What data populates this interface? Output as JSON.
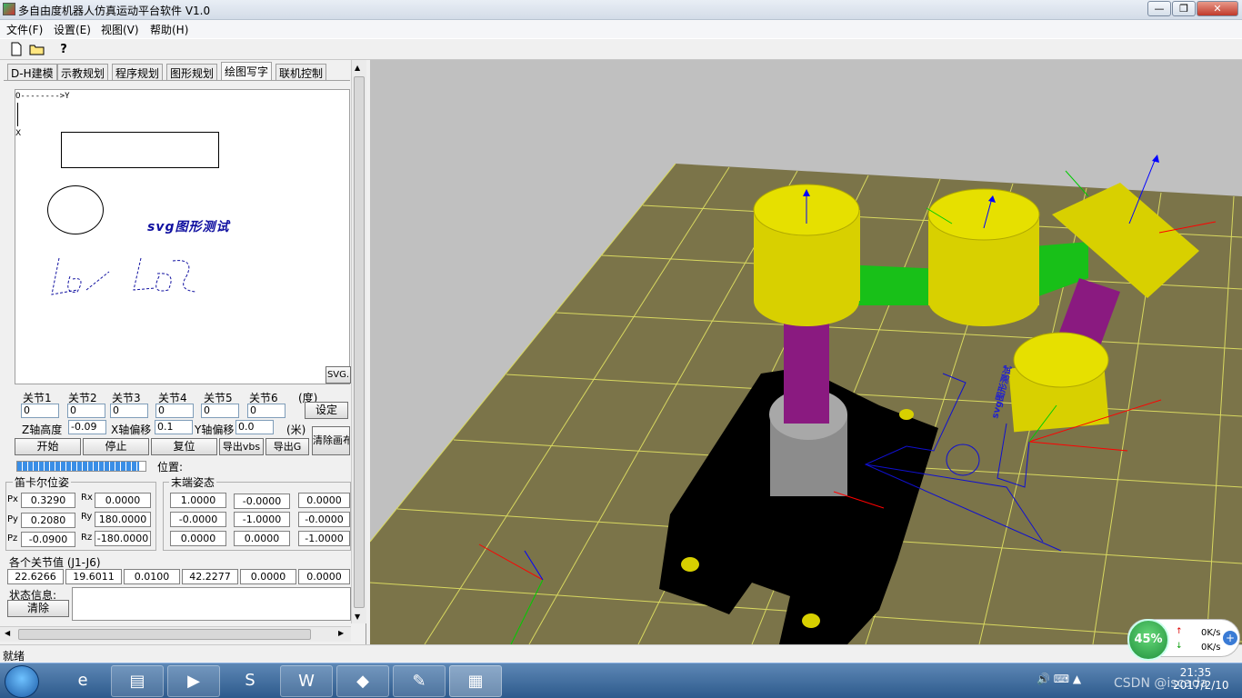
{
  "window": {
    "title": "多自由度机器人仿真运动平台软件 V1.0",
    "min": "—",
    "max": "❐",
    "close": "✕"
  },
  "menu": [
    "文件(F)",
    "设置(E)",
    "视图(V)",
    "帮助(H)"
  ],
  "toolbar": {
    "new_icon": "new-file-icon",
    "open_icon": "open-folder-icon",
    "help_icon": "help-icon",
    "help_label": "?"
  },
  "tabs": [
    "D-H建模",
    "示教规划",
    "程序规划",
    "图形规划",
    "绘图写字",
    "联机控制"
  ],
  "active_tab": 4,
  "drawing": {
    "axis_origin": "O-------->Y",
    "axis_x": "X",
    "svg_text": "svg图形测试",
    "svg_button": "SVG."
  },
  "joints": {
    "labels": [
      "关节1",
      "关节2",
      "关节3",
      "关节4",
      "关节5",
      "关节6"
    ],
    "values": [
      "0",
      "0",
      "0",
      "0",
      "0",
      "0"
    ],
    "unit": "(度)",
    "set_button": "设定"
  },
  "offsets": {
    "z_label": "Z轴高度",
    "z_value": "-0.09",
    "x_label": "X轴偏移",
    "x_value": "0.1",
    "y_label": "Y轴偏移",
    "y_value": "0.0",
    "unit": "(米)",
    "clear_button": "清除画布"
  },
  "controls": [
    "开始",
    "停止",
    "复位",
    "导出vbs",
    "导出G"
  ],
  "progress": {
    "fraction": 0.95,
    "position_label": "位置:"
  },
  "cartesian": {
    "title": "笛卡尔位姿",
    "rows": [
      {
        "plabel": "Px",
        "pval": "0.3290",
        "rlabel": "Rx",
        "rval": "0.0000"
      },
      {
        "plabel": "Py",
        "pval": "0.2080",
        "rlabel": "Ry",
        "rval": "180.0000"
      },
      {
        "plabel": "Pz",
        "pval": "-0.0900",
        "rlabel": "Rz",
        "rval": "-180.0000"
      }
    ]
  },
  "end_pose": {
    "title": "末端姿态",
    "matrix": [
      [
        "1.0000",
        "-0.0000",
        "0.0000"
      ],
      [
        "-0.0000",
        "-1.0000",
        "-0.0000"
      ],
      [
        "0.0000",
        "0.0000",
        "-1.0000"
      ]
    ]
  },
  "joint_values": {
    "title": "各个关节值 (J1-J6)",
    "values": [
      "22.6266",
      "19.6011",
      "0.0100",
      "42.2277",
      "0.0000",
      "0.0000"
    ]
  },
  "status": {
    "label": "状态信息:",
    "clear_button": "清除",
    "text": ""
  },
  "statusbar": {
    "text": "就绪"
  },
  "network": {
    "percent": "45%",
    "up": "0K/s",
    "down": "0K/s"
  },
  "taskbar": {
    "apps": [
      "ie-icon",
      "explorer-icon",
      "media-player-icon",
      "sogou-icon",
      "word-icon",
      "app-icon",
      "paint-icon",
      "mfc-icon"
    ],
    "time": "21:35",
    "date": "2017/2/10",
    "watermark": "CSDN @iscada"
  },
  "scene_colors": {
    "floor": "#7b7449",
    "grid": "#d8d860",
    "joint": "#d8d000",
    "link_green": "#18c018",
    "link_purple": "#8a1a80",
    "base": "#000000",
    "pedestal": "#8c8c8c",
    "path": "#1010d0"
  }
}
